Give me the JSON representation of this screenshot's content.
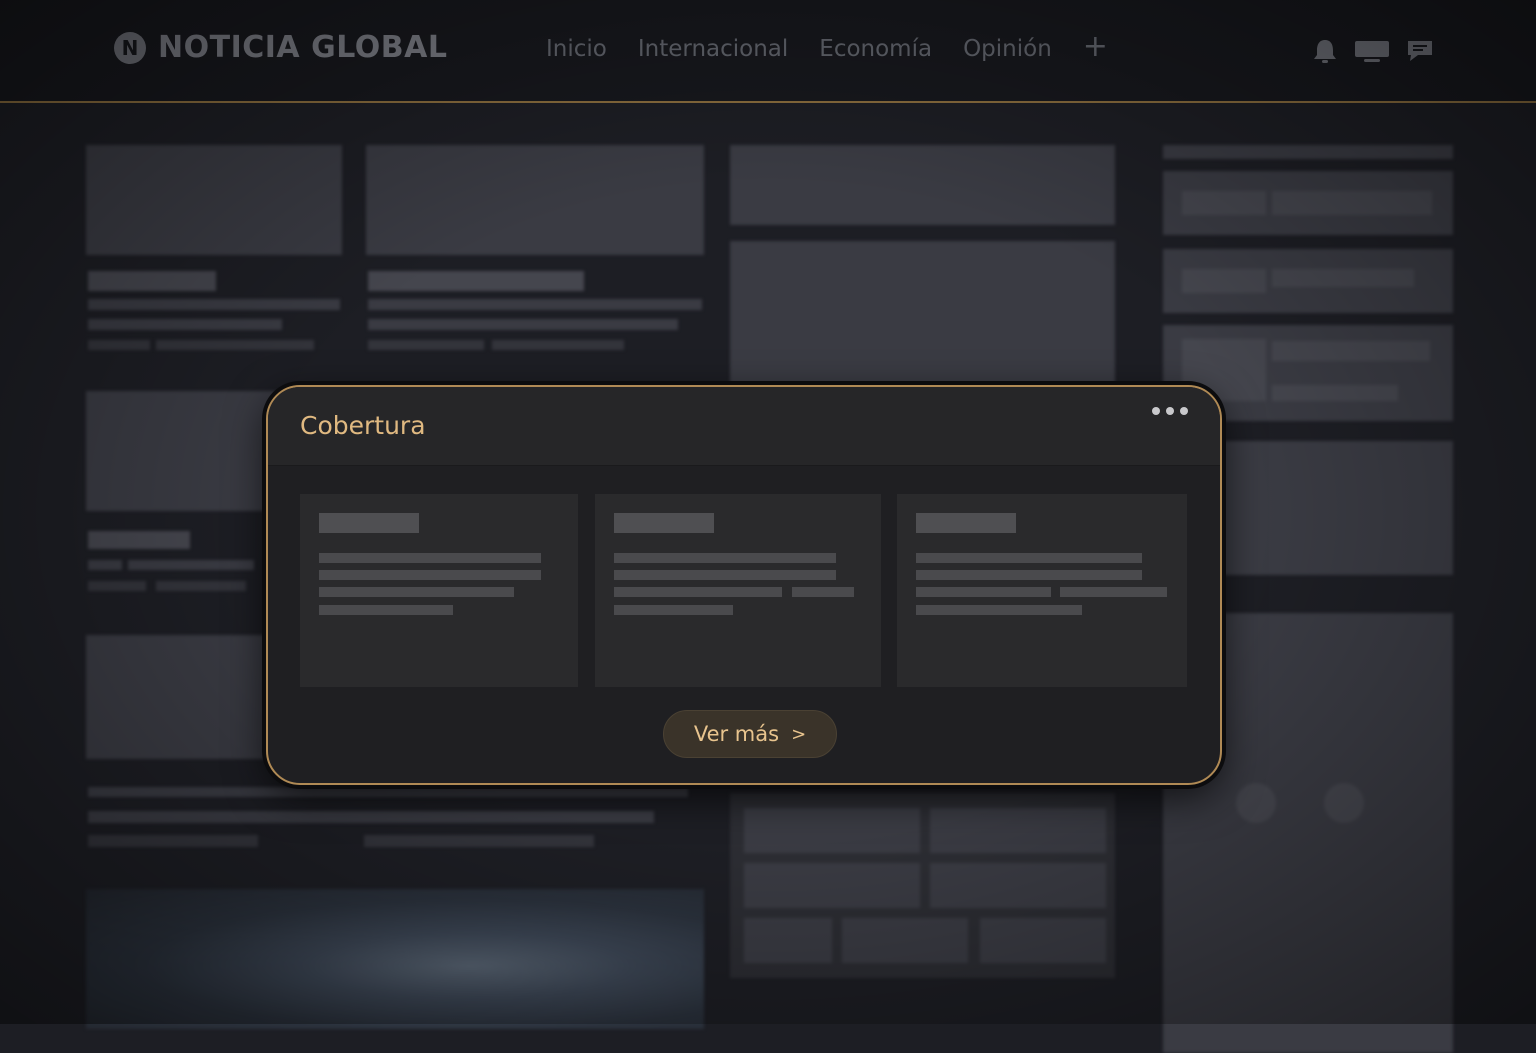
{
  "header": {
    "logo_text": "NOTICIA GLOBAL",
    "logo_mark": "N",
    "nav": [
      "Inicio",
      "Internacional",
      "Economía",
      "Opinión"
    ],
    "nav_add_symbol": "+",
    "icons": [
      "bell-icon",
      "screen-icon",
      "chat-icon"
    ]
  },
  "modal": {
    "title": "Cobertura",
    "more_label": "Ver más",
    "more_chevron": ">",
    "menu_icon": "more-dots-icon",
    "card_count": 3
  },
  "colors": {
    "accent_gold": "#b08a55",
    "title_gold": "#e0b981",
    "background": "#1d1e24"
  }
}
